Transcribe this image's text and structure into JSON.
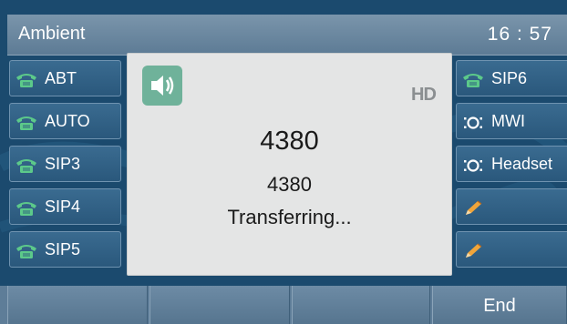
{
  "title_bar": {
    "title": "Ambient",
    "clock": "16 : 57"
  },
  "line_keys_left": [
    {
      "label": "ABT",
      "icon": "phone-icon"
    },
    {
      "label": "AUTO",
      "icon": "phone-icon"
    },
    {
      "label": "SIP3",
      "icon": "phone-icon"
    },
    {
      "label": "SIP4",
      "icon": "phone-icon"
    },
    {
      "label": "SIP5",
      "icon": "phone-icon"
    }
  ],
  "line_keys_right": [
    {
      "label": "SIP6",
      "icon": "phone-icon"
    },
    {
      "label": "MWI",
      "icon": "voicemail-icon"
    },
    {
      "label": "Headset",
      "icon": "voicemail-icon"
    },
    {
      "label": "",
      "icon": "pencil-icon"
    },
    {
      "label": "",
      "icon": "pencil-icon"
    }
  ],
  "call": {
    "audio_icon": "speaker-icon",
    "hd_badge": "HD",
    "number": "4380",
    "caller": "4380",
    "status": "Transferring..."
  },
  "soft_keys": [
    "",
    "",
    "",
    "End"
  ],
  "colors": {
    "background": "#1b4a6e",
    "panel": "#e4e5e5",
    "phone_icon_green": "#5cc98a",
    "pencil_orange": "#f0a53a",
    "speaker_badge": "#6fb29a"
  }
}
